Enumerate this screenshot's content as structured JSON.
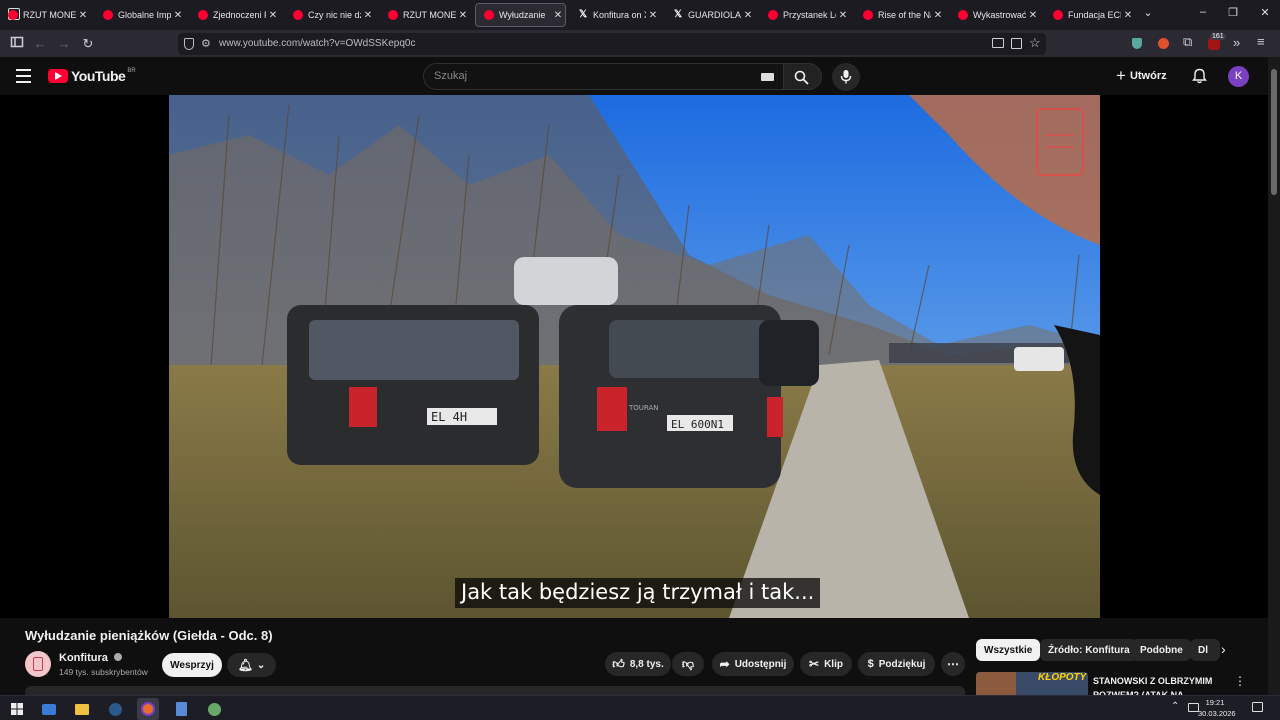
{
  "browser": {
    "tabs": [
      {
        "label": "RZUT MONETĄ",
        "icon": "youtube-icon"
      },
      {
        "label": "Globalne Imperi",
        "icon": "youtube-icon"
      },
      {
        "label": "Zjednoczeni Prz",
        "icon": "youtube-icon"
      },
      {
        "label": "Czy nic nie dzie",
        "icon": "youtube-icon"
      },
      {
        "label": "RZUT MONETĄ",
        "icon": "youtube-icon"
      },
      {
        "label": "Wyłudzanie",
        "icon": "youtube-icon",
        "active": true
      },
      {
        "label": "Konfitura on X",
        "icon": "x-icon"
      },
      {
        "label": "GUARDIOLA",
        "icon": "x-icon"
      },
      {
        "label": "Przystanek Lom",
        "icon": "youtube-icon"
      },
      {
        "label": "Rise of the Nazi",
        "icon": "youtube-icon"
      },
      {
        "label": "Wykastrować b",
        "icon": "youtube-icon"
      },
      {
        "label": "Fundacja ECPU",
        "icon": "youtube-icon"
      }
    ],
    "url": "www.youtube.com/watch?v=OWdSSKepq0c",
    "extension_badge": "161"
  },
  "youtube": {
    "logo_text": "YouTube",
    "country_code": "BR",
    "search_placeholder": "Szukaj",
    "create_label": "Utwórz",
    "avatar_letter": "K"
  },
  "video": {
    "subtitle": "Jak tak będziesz ją trzymał i tak...",
    "plates": [
      "EL 4H",
      "EL 600N1"
    ],
    "car_badge": "TOURAN"
  },
  "details": {
    "title": "Wyłudzanie pieniążków (Giełda - Odc. 8)",
    "channel": "Konfitura",
    "subscribers": "149 tys. subskrybentów",
    "support_label": "Wesprzyj",
    "likes": "8,8 tys.",
    "share_label": "Udostępnij",
    "clip_label": "Klip",
    "thanks_label": "Podziękuj"
  },
  "sidebar": {
    "chips": [
      "Wszystkie",
      "Źródło: Konfitura",
      "Podobne",
      "Dl"
    ],
    "next_video_title": "STANOWSKI Z OLBRZYMIM POZWEM? (ATAK NA",
    "thumb_text": "KŁOPOTY"
  },
  "taskbar": {
    "time": "19:21",
    "date": "30.03.2026"
  },
  "colors": {
    "youtube_red": "#ff0033",
    "background": "#0f0f0f",
    "avatar": "#7b3fc4"
  }
}
